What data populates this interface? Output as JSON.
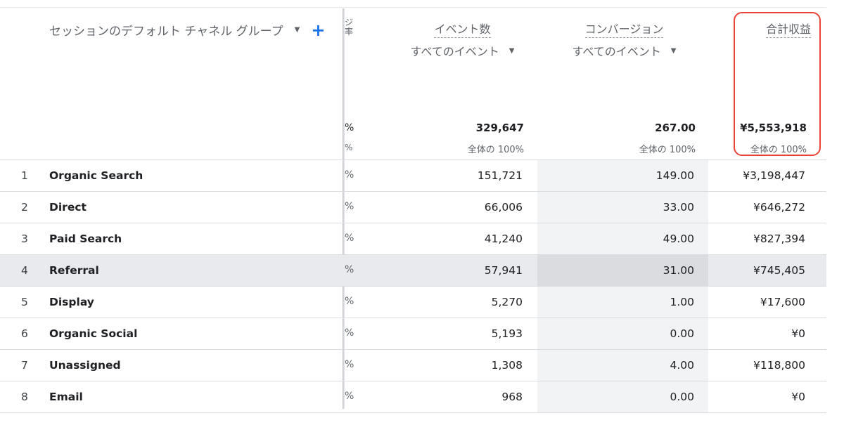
{
  "header": {
    "dimension_label": "セッションのデフォルト チャネル グループ",
    "clipped_column_text": "ジ\n率",
    "clipped_total_value": "%",
    "clipped_total_pct": "%",
    "event_count": {
      "title": "イベント数",
      "filter": "すべてのイベント"
    },
    "conversions": {
      "title": "コンバージョン",
      "filter": "すべてのイベント"
    },
    "total_revenue": {
      "title": "合計収益"
    }
  },
  "totals": {
    "event_count": "329,647",
    "event_count_pct": "全体の 100%",
    "conversions": "267.00",
    "conversions_pct": "全体の 100%",
    "total_revenue": "¥5,553,918",
    "total_revenue_pct": "全体の 100%"
  },
  "rows": [
    {
      "idx": "1",
      "name": "Organic Search",
      "pct": "%",
      "events": "151,721",
      "conversions": "149.00",
      "revenue": "¥3,198,447"
    },
    {
      "idx": "2",
      "name": "Direct",
      "pct": "%",
      "events": "66,006",
      "conversions": "33.00",
      "revenue": "¥646,272"
    },
    {
      "idx": "3",
      "name": "Paid Search",
      "pct": "%",
      "events": "41,240",
      "conversions": "49.00",
      "revenue": "¥827,394"
    },
    {
      "idx": "4",
      "name": "Referral",
      "pct": "%",
      "events": "57,941",
      "conversions": "31.00",
      "revenue": "¥745,405"
    },
    {
      "idx": "5",
      "name": "Display",
      "pct": "%",
      "events": "5,270",
      "conversions": "1.00",
      "revenue": "¥17,600"
    },
    {
      "idx": "6",
      "name": "Organic Social",
      "pct": "%",
      "events": "5,193",
      "conversions": "0.00",
      "revenue": "¥0"
    },
    {
      "idx": "7",
      "name": "Unassigned",
      "pct": "%",
      "events": "1,308",
      "conversions": "4.00",
      "revenue": "¥118,800"
    },
    {
      "idx": "8",
      "name": "Email",
      "pct": "%",
      "events": "968",
      "conversions": "0.00",
      "revenue": "¥0"
    }
  ],
  "colors": {
    "accent": "#1a73e8",
    "highlight_border": "#ea4335",
    "hover_row": "#e8eaed",
    "conversion_column_bg": "#f1f3f4"
  },
  "icons": {
    "dropdown": "caret-down-icon",
    "add_dimension": "plus-icon"
  }
}
